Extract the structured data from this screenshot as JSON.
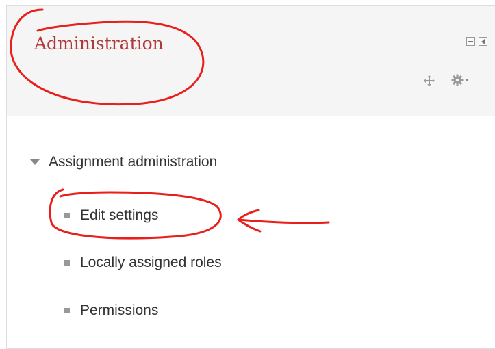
{
  "block": {
    "title": "Administration",
    "controls": {
      "hide_icon": "minus-box-icon",
      "dock_icon": "dock-left-icon",
      "move_icon": "move-arrows-icon",
      "actions_icon": "gear-icon"
    }
  },
  "menu": {
    "section": {
      "label": "Assignment administration",
      "state": "expanded"
    },
    "items": [
      {
        "label": "Edit settings"
      },
      {
        "label": "Locally assigned roles"
      },
      {
        "label": "Permissions"
      }
    ]
  },
  "annotations": {
    "color": "#e8201c"
  },
  "colors": {
    "title": "#b03a3a",
    "text": "#333333",
    "header_bg": "#f5f5f5",
    "border": "#dddddd"
  }
}
